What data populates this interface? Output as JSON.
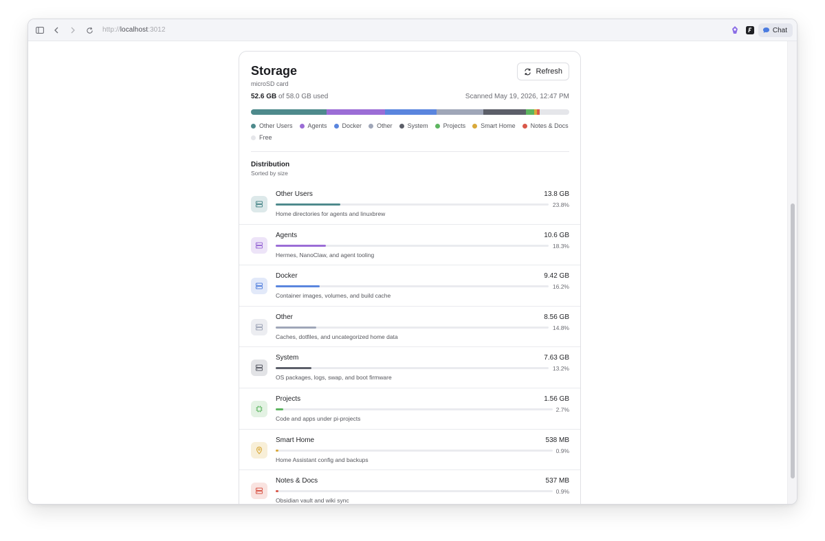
{
  "browser": {
    "url_scheme": "http://",
    "url_host": "localhost",
    "url_port": ":3012",
    "chat_label": "Chat"
  },
  "card": {
    "title": "Storage",
    "subtitle": "microSD card",
    "refresh_label": "Refresh",
    "used": "52.6 GB",
    "of_total": "of 58.0 GB used",
    "scanned": "Scanned May 19, 2026, 12:47 PM"
  },
  "colors": {
    "other_users": "#4e8a8c",
    "agents": "#9b6dd6",
    "docker": "#5a85de",
    "other": "#9fa6b8",
    "system": "#5c5f69",
    "projects": "#5db560",
    "smart_home": "#d9a93a",
    "notes_docs": "#d9584a",
    "free": "#e5e6ea"
  },
  "legend": [
    {
      "label": "Other Users",
      "color": "#4e8a8c"
    },
    {
      "label": "Agents",
      "color": "#9b6dd6"
    },
    {
      "label": "Docker",
      "color": "#5a85de"
    },
    {
      "label": "Other",
      "color": "#9fa6b8"
    },
    {
      "label": "System",
      "color": "#5c5f69"
    },
    {
      "label": "Projects",
      "color": "#5db560"
    },
    {
      "label": "Smart Home",
      "color": "#d9a93a"
    },
    {
      "label": "Notes & Docs",
      "color": "#d9584a"
    },
    {
      "label": "Free",
      "color": "#e5e6ea"
    }
  ],
  "distribution": {
    "title": "Distribution",
    "subtitle": "Sorted by size",
    "rows": [
      {
        "name": "Other Users",
        "size": "13.8 GB",
        "pct": "23.8%",
        "fraction": 0.238,
        "desc": "Home directories for agents and linuxbrew",
        "color": "#4e8a8c",
        "bg": "#dde9ea",
        "icon": "server-icon"
      },
      {
        "name": "Agents",
        "size": "10.6 GB",
        "pct": "18.3%",
        "fraction": 0.183,
        "desc": "Hermes, NanoClaw, and agent tooling",
        "color": "#9b6dd6",
        "bg": "#ede4f8",
        "icon": "server-icon"
      },
      {
        "name": "Docker",
        "size": "9.42 GB",
        "pct": "16.2%",
        "fraction": 0.162,
        "desc": "Container images, volumes, and build cache",
        "color": "#5a85de",
        "bg": "#e2e9f9",
        "icon": "server-icon"
      },
      {
        "name": "Other",
        "size": "8.56 GB",
        "pct": "14.8%",
        "fraction": 0.148,
        "desc": "Caches, dotfiles, and uncategorized home data",
        "color": "#9fa6b8",
        "bg": "#ecedf1",
        "icon": "server-icon"
      },
      {
        "name": "System",
        "size": "7.63 GB",
        "pct": "13.2%",
        "fraction": 0.132,
        "desc": "OS packages, logs, swap, and boot firmware",
        "color": "#5c5f69",
        "bg": "#e2e3e6",
        "icon": "server-icon"
      },
      {
        "name": "Projects",
        "size": "1.56 GB",
        "pct": "2.7%",
        "fraction": 0.027,
        "desc": "Code and apps under pi-projects",
        "color": "#5db560",
        "bg": "#e3f2e3",
        "icon": "chip-icon"
      },
      {
        "name": "Smart Home",
        "size": "538 MB",
        "pct": "0.9%",
        "fraction": 0.009,
        "desc": "Home Assistant config and backups",
        "color": "#d9a93a",
        "bg": "#f8efd8",
        "icon": "location-pin-icon"
      },
      {
        "name": "Notes & Docs",
        "size": "537 MB",
        "pct": "0.9%",
        "fraction": 0.009,
        "desc": "Obsidian vault and wiki sync",
        "color": "#d9584a",
        "bg": "#f9e3e0",
        "icon": "server-icon"
      }
    ]
  }
}
